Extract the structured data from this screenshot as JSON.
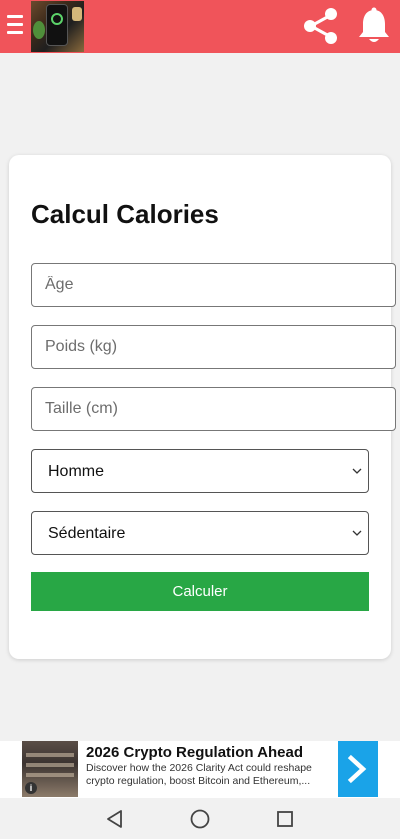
{
  "header": {
    "bg_color": "#f0545a",
    "menu_icon": "hamburger-menu-icon",
    "share_icon": "share-icon",
    "bell_icon": "bell-icon"
  },
  "form": {
    "title": "Calcul Calories",
    "age_placeholder": "Âge",
    "weight_placeholder": "Poids (kg)",
    "height_placeholder": "Taille (cm)",
    "gender_selected": "Homme",
    "activity_selected": "Sédentaire",
    "submit_label": "Calculer",
    "submit_color": "#28a745"
  },
  "ad": {
    "title": "2026 Crypto Regulation Ahead",
    "description": "Discover how the 2026 Clarity Act could reshape crypto regulation, boost Bitcoin and Ethereum,...",
    "info_label": "i",
    "arrow_color": "#1aa3e8"
  },
  "navbar": {
    "back_icon": "back-triangle-icon",
    "home_icon": "home-circle-icon",
    "recents_icon": "recents-square-icon"
  }
}
